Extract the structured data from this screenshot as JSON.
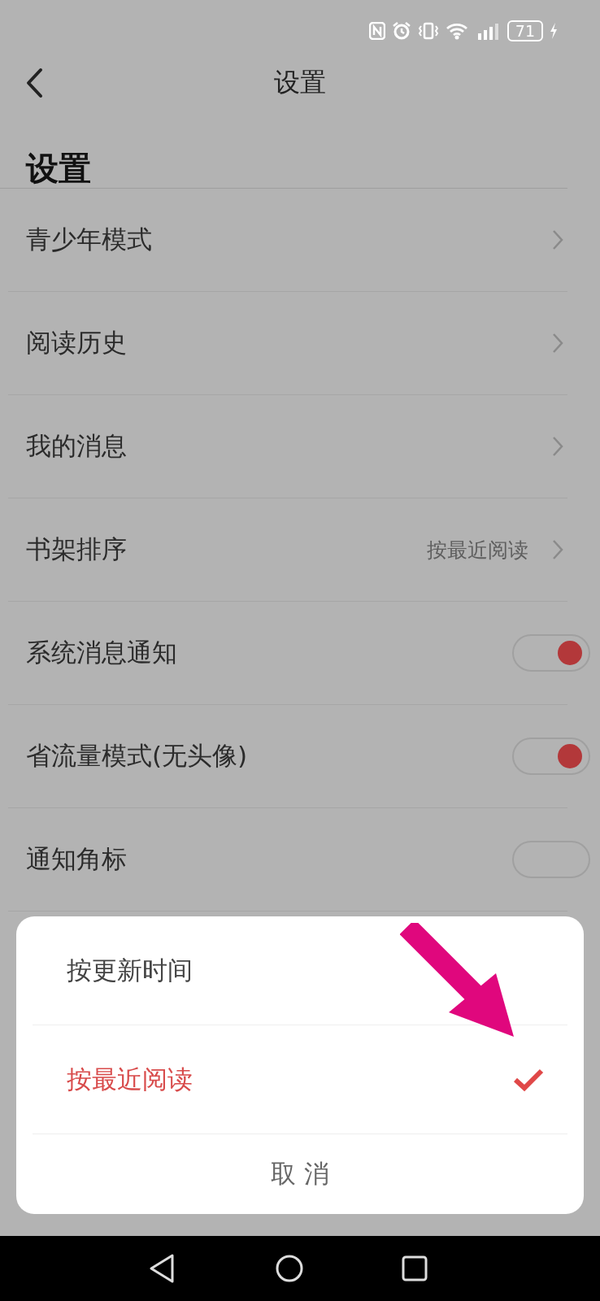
{
  "status_bar": {
    "battery": "71"
  },
  "header": {
    "title": "设置"
  },
  "section": {
    "heading": "设置"
  },
  "rows": [
    {
      "kind": "link",
      "label": "青少年模式"
    },
    {
      "kind": "link",
      "label": "阅读历史"
    },
    {
      "kind": "link",
      "label": "我的消息"
    },
    {
      "kind": "link",
      "label": "书架排序",
      "value": "按最近阅读"
    },
    {
      "kind": "toggle",
      "label": "系统消息通知",
      "on": true
    },
    {
      "kind": "toggle",
      "label": "省流量模式(无头像)",
      "on": true
    },
    {
      "kind": "toggle",
      "label": "通知角标",
      "on": false
    }
  ],
  "sheet": {
    "options": [
      {
        "label": "按更新时间",
        "selected": false
      },
      {
        "label": "按最近阅读",
        "selected": true
      }
    ],
    "cancel": "取 消"
  }
}
